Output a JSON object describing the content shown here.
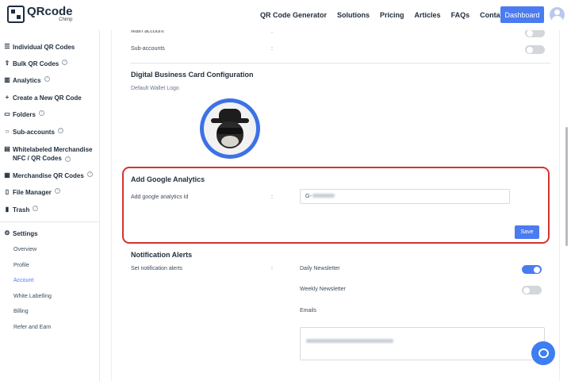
{
  "brand": {
    "name": "QRcode",
    "sub": "Chimp"
  },
  "nav": {
    "items": [
      "QR Code Generator",
      "Solutions",
      "Pricing",
      "Articles",
      "FAQs",
      "Contact Us"
    ],
    "dashboard_label": "Dashboard"
  },
  "sidebar": {
    "items": [
      {
        "label": "Individual QR Codes",
        "icon": "list-icon"
      },
      {
        "label": "Bulk QR Codes",
        "icon": "upload-icon"
      },
      {
        "label": "Analytics",
        "icon": "bar-chart-icon"
      },
      {
        "label": "Create a New QR Code",
        "icon": "plus-icon"
      },
      {
        "label": "Folders",
        "icon": "folder-icon"
      },
      {
        "label": "Sub-accounts",
        "icon": "user-icon"
      },
      {
        "label": "Whitelabeled Merchandise",
        "label2": "NFC / QR Codes",
        "icon": "tag-icon"
      },
      {
        "label": "Merchandise QR Codes",
        "icon": "gift-icon"
      },
      {
        "label": "File Manager",
        "icon": "file-icon"
      },
      {
        "label": "Trash",
        "icon": "trash-icon"
      }
    ],
    "settings_label": "Settings",
    "settings_sub": [
      "Overview",
      "Profile",
      "Account",
      "White Labelling",
      "Billing",
      "Refer and Earn"
    ]
  },
  "account": {
    "main_account": "Main account",
    "sub_accounts": "Sub-accounts",
    "colon": ":"
  },
  "business_card": {
    "title": "Digital Business Card Configuration",
    "wallet_logo_label": "Default Wallet Logo"
  },
  "analytics": {
    "title": "Add Google Analytics",
    "field_label": "Add google analytics Id",
    "field_value_prefix": "G-",
    "save_label": "Save"
  },
  "notifications": {
    "title": "Notification Alerts",
    "set_label": "Set notification alerts",
    "daily": {
      "label": "Daily Newsletter",
      "on": true
    },
    "weekly": {
      "label": "Weekly Newsletter",
      "on": false
    },
    "emails_label": "Emails"
  },
  "colors": {
    "accent": "#4a7cf0",
    "highlight": "#d63232"
  }
}
